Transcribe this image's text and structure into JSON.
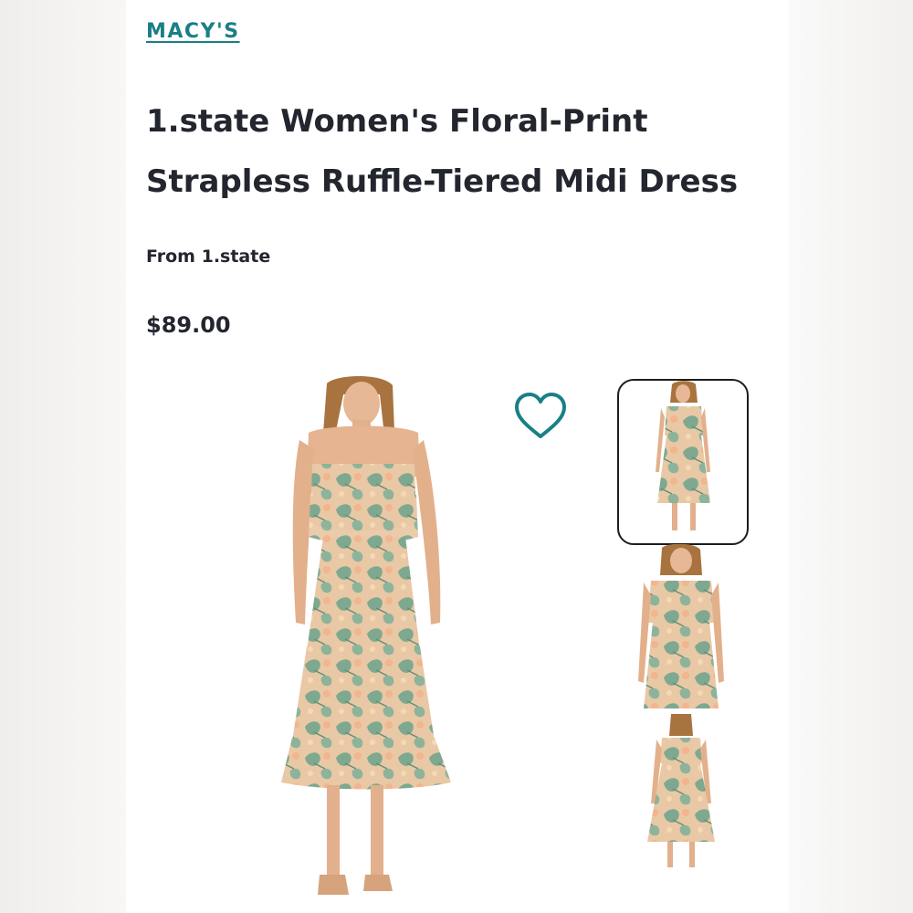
{
  "store": {
    "name": "MACY'S"
  },
  "product": {
    "title": "1.state Women's Floral-Print Strapless Ruffle-Tiered Midi Dress",
    "brand_line": "From 1.state",
    "price": "$89.00"
  },
  "colors": {
    "accent": "#1a7f86",
    "text": "#23262e",
    "dress_base": "#e8c7a4",
    "dress_pattern": "#7fa890"
  },
  "icons": {
    "wishlist": "heart-outline-icon"
  },
  "images": {
    "main": "dress-front-full-view",
    "thumbnails": [
      "dress-front-full-view",
      "dress-front-close-up",
      "dress-back-view"
    ]
  }
}
